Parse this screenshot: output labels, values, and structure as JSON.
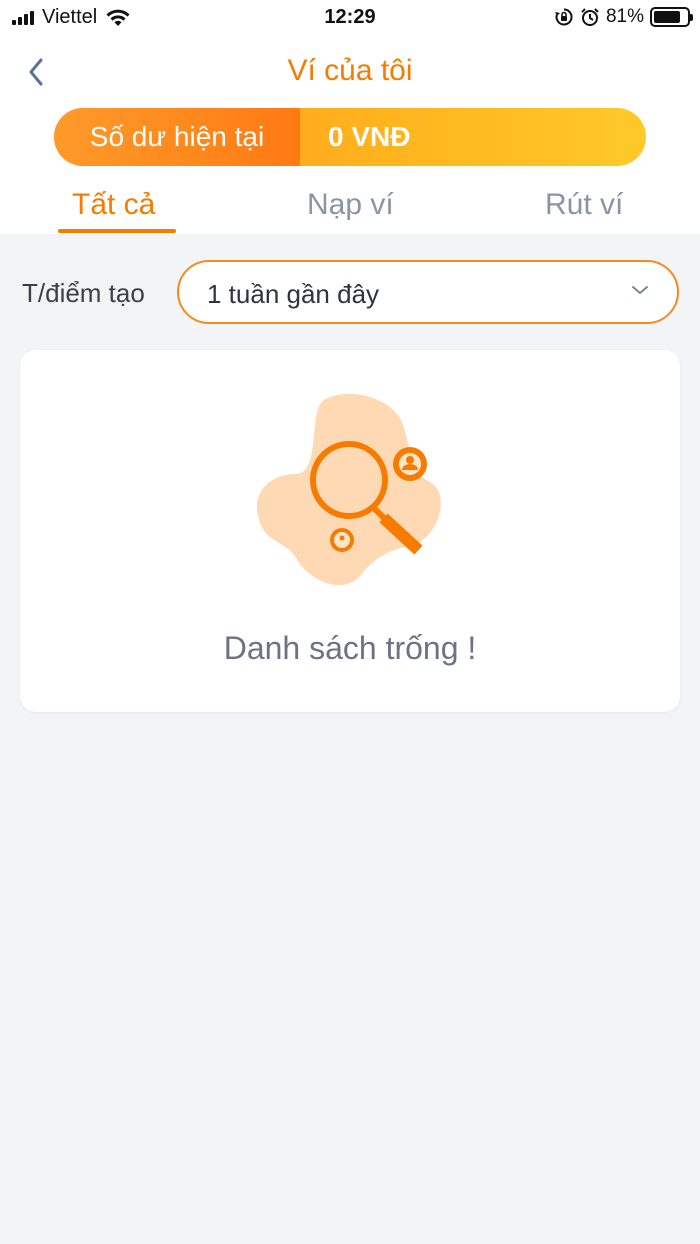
{
  "status_bar": {
    "carrier": "Viettel",
    "time": "12:29",
    "battery": "81%"
  },
  "header": {
    "title": "Ví của tôi",
    "back_icon": "chevron-left-icon"
  },
  "balance": {
    "label": "Số dư hiện tại",
    "value": "0 VNĐ"
  },
  "tabs": [
    {
      "label": "Tất cả",
      "active": true
    },
    {
      "label": "Nạp ví",
      "active": false
    },
    {
      "label": "Rút ví",
      "active": false
    }
  ],
  "filter": {
    "label": "T/điểm tạo",
    "selected": "1 tuần gần đây"
  },
  "empty_state": {
    "text": "Danh sách trống !",
    "icon": "search-empty-illustration"
  },
  "colors": {
    "accent": "#f57c00",
    "background": "#f3f4f6"
  }
}
